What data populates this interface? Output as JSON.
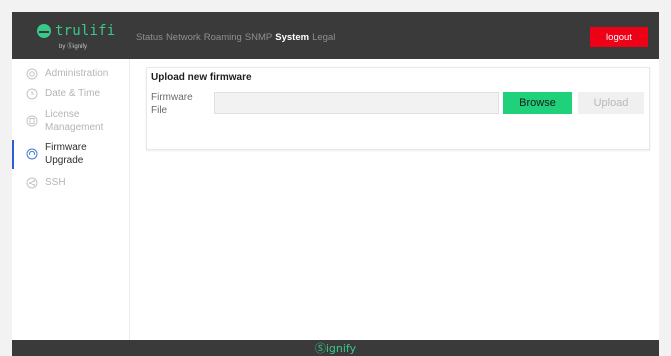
{
  "brand": {
    "name": "trulifi",
    "sub": "by Ⓢignify",
    "accent_color": "#38c98a"
  },
  "topnav": {
    "items": [
      {
        "label": "Status",
        "active": false
      },
      {
        "label": "Network",
        "active": false
      },
      {
        "label": "Roaming",
        "active": false
      },
      {
        "label": "SNMP",
        "active": false
      },
      {
        "label": "System",
        "active": true
      },
      {
        "label": "Legal",
        "active": false
      }
    ]
  },
  "logout": {
    "label": "logout",
    "color": "#ee0016"
  },
  "sidebar": {
    "items": [
      {
        "label": "Administration",
        "icon": "gear-icon",
        "active": false
      },
      {
        "label": "Date & Time",
        "icon": "clock-icon",
        "active": false
      },
      {
        "label": "License Management",
        "icon": "license-icon",
        "active": false
      },
      {
        "label": "Firmware Upgrade",
        "icon": "firmware-icon",
        "active": true
      },
      {
        "label": "SSH",
        "icon": "share-icon",
        "active": false
      }
    ]
  },
  "upload": {
    "title": "Upload new firmware",
    "field_label": "Firmware File",
    "file_value": "",
    "browse_label": "Browse",
    "upload_label": "Upload"
  },
  "footer": {
    "brand": "Ⓢignify"
  }
}
